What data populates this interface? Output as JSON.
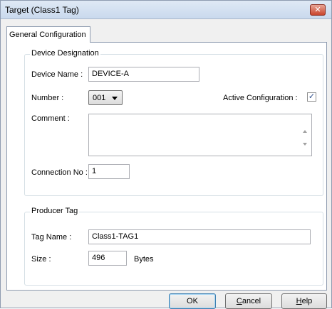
{
  "window": {
    "title": "Target (Class1 Tag)",
    "close_glyph": "✕"
  },
  "tabs": [
    {
      "label": "General Configuration",
      "selected": true
    }
  ],
  "device_designation": {
    "legend": "Device Designation",
    "device_name_label": "Device Name :",
    "device_name_value": "DEVICE-A",
    "number_label": "Number :",
    "number_value": "001",
    "active_config_label": "Active Configuration :",
    "active_config_checked": true,
    "check_glyph": "✓",
    "comment_label": "Comment :",
    "comment_value": "",
    "connection_no_label": "Connection No :",
    "connection_no_value": "1"
  },
  "producer_tag": {
    "legend": "Producer Tag",
    "tag_name_label": "Tag Name :",
    "tag_name_value": "Class1-TAG1",
    "size_label": "Size :",
    "size_value": "496",
    "size_unit": "Bytes"
  },
  "buttons": {
    "ok": "OK",
    "cancel_first": "C",
    "cancel_rest": "ancel",
    "help_first": "H",
    "help_rest": "elp"
  }
}
